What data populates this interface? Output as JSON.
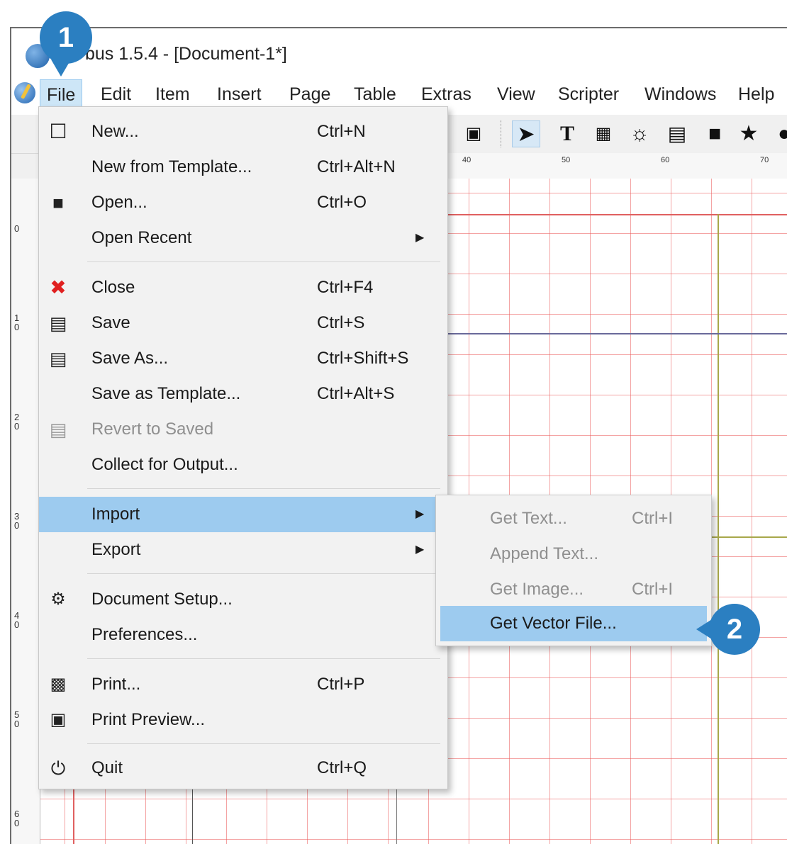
{
  "window": {
    "title": "bus 1.5.4 - [Document-1*]"
  },
  "menubar": {
    "items": [
      "File",
      "Edit",
      "Item",
      "Insert",
      "Page",
      "Table",
      "Extras",
      "View",
      "Scripter",
      "Windows",
      "Help"
    ]
  },
  "toolbar": {
    "icons": [
      "pdf-import-icon",
      "select-arrow-icon",
      "text-frame-icon",
      "image-frame-icon",
      "render-frame-icon",
      "table-icon",
      "shape-icon",
      "polygon-star-icon",
      "arc-icon"
    ]
  },
  "ruler": {
    "horizontal": [
      "40",
      "50",
      "60",
      "70"
    ],
    "vertical": [
      "0",
      "10",
      "20",
      "30",
      "40",
      "50",
      "60"
    ]
  },
  "file_menu": {
    "items": [
      {
        "icon": "new-document-icon",
        "label": "New...",
        "shortcut": "Ctrl+N"
      },
      {
        "icon": "",
        "label": "New from Template...",
        "shortcut": "Ctrl+Alt+N"
      },
      {
        "icon": "folder-icon",
        "label": "Open...",
        "shortcut": "Ctrl+O"
      },
      {
        "icon": "",
        "label": "Open Recent",
        "shortcut": "",
        "submenu": true
      },
      {
        "icon": "close-x-icon",
        "label": "Close",
        "shortcut": "Ctrl+F4"
      },
      {
        "icon": "save-disk-icon",
        "label": "Save",
        "shortcut": "Ctrl+S"
      },
      {
        "icon": "save-as-disk-icon",
        "label": "Save As...",
        "shortcut": "Ctrl+Shift+S"
      },
      {
        "icon": "",
        "label": "Save as Template...",
        "shortcut": "Ctrl+Alt+S"
      },
      {
        "icon": "revert-disk-icon",
        "label": "Revert to Saved",
        "shortcut": "",
        "disabled": true
      },
      {
        "icon": "",
        "label": "Collect for Output...",
        "shortcut": ""
      },
      {
        "icon": "",
        "label": "Import",
        "shortcut": "",
        "submenu": true,
        "highlighted": true
      },
      {
        "icon": "",
        "label": "Export",
        "shortcut": "",
        "submenu": true
      },
      {
        "icon": "document-setup-icon",
        "label": "Document Setup...",
        "shortcut": ""
      },
      {
        "icon": "",
        "label": "Preferences...",
        "shortcut": ""
      },
      {
        "icon": "printer-icon",
        "label": "Print...",
        "shortcut": "Ctrl+P"
      },
      {
        "icon": "print-preview-icon",
        "label": "Print Preview...",
        "shortcut": ""
      },
      {
        "icon": "power-icon",
        "label": "Quit",
        "shortcut": "Ctrl+Q"
      }
    ]
  },
  "import_submenu": {
    "items": [
      {
        "label": "Get Text...",
        "shortcut": "Ctrl+I",
        "disabled": true
      },
      {
        "label": "Append Text...",
        "shortcut": "",
        "disabled": true
      },
      {
        "label": "Get Image...",
        "shortcut": "Ctrl+I",
        "disabled": true
      },
      {
        "label": "Get Vector File...",
        "shortcut": "",
        "highlighted": true
      }
    ]
  },
  "annotations": {
    "step1": "1",
    "step2": "2"
  },
  "colors": {
    "accent": "#2b7fc1",
    "menu_highlight": "#9dcbef",
    "grid": "#eb5a5a"
  }
}
